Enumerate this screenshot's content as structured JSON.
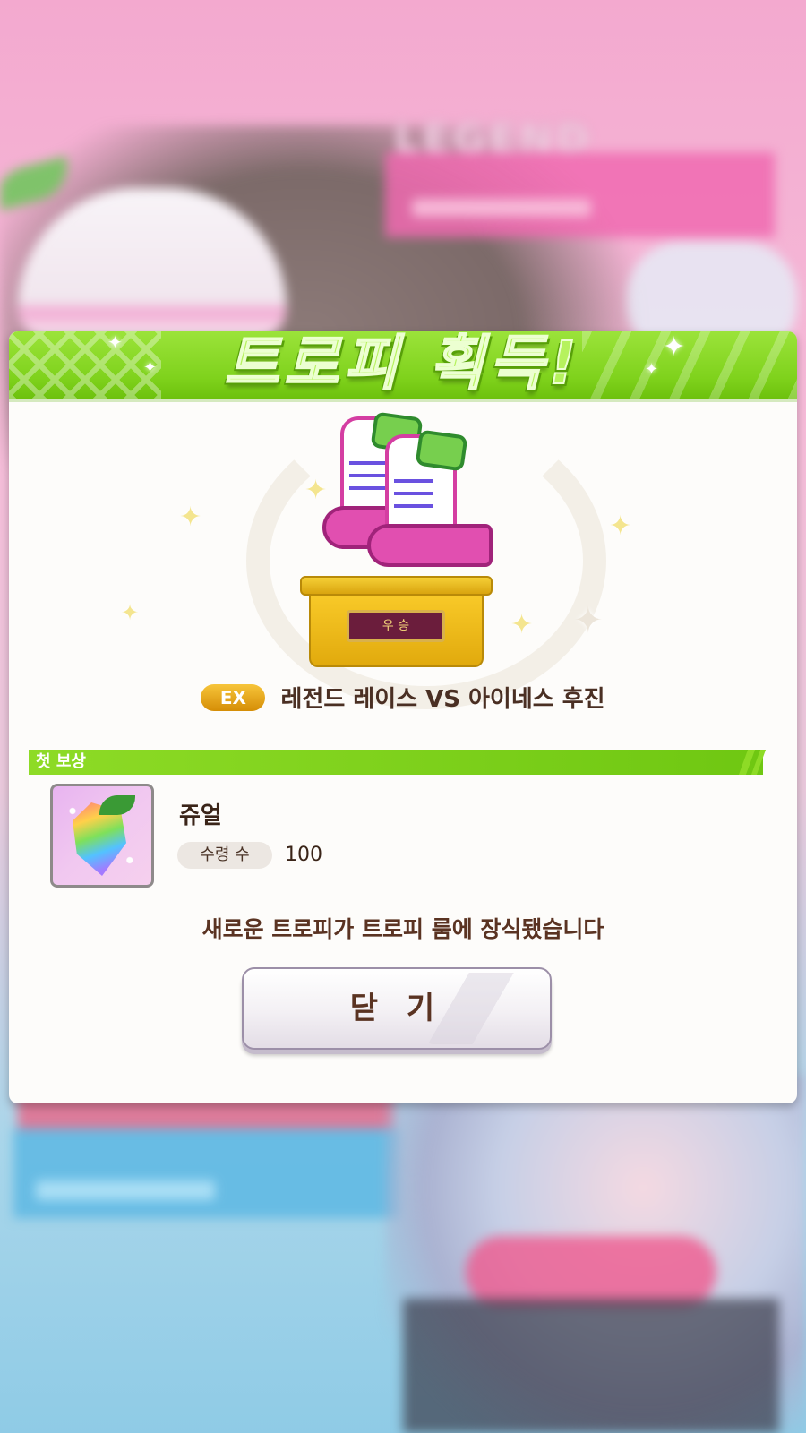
{
  "background": {
    "legend_text": "LEGEND"
  },
  "modal": {
    "title": "트로피 획득!",
    "trophy": {
      "plate_text": "우 승",
      "badge": "EX",
      "race_name": "레전드 레이스 VS 아이네스 후진"
    },
    "reward_section": {
      "header": "첫 보상",
      "item_name": "쥬얼",
      "quantity_label": "수령 수",
      "quantity_value": "100"
    },
    "message": "새로운 트로피가 트로피 룸에 장식됐습니다",
    "close_button": "닫 기"
  },
  "colors": {
    "header_green": "#7fd21c",
    "brown_text": "#5a3322",
    "gold": "#f0b820",
    "pink": "#e14fb0"
  },
  "icons": [
    "sparkle-icon",
    "jewel-icon",
    "trophy-icon"
  ]
}
